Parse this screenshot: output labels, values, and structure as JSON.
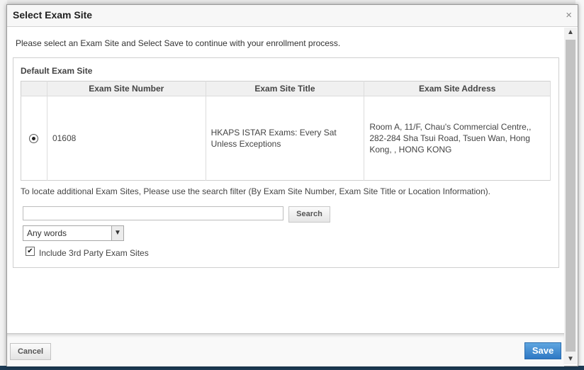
{
  "dialog": {
    "title": "Select Exam Site",
    "close_glyph": "×",
    "intro": "Please select an Exam Site and Select Save to continue with your enrollment process."
  },
  "default_site": {
    "legend": "Default Exam Site",
    "columns": [
      "Exam Site Number",
      "Exam Site Title",
      "Exam Site Address"
    ],
    "rows": [
      {
        "selected": true,
        "number": "01608",
        "title": "HKAPS ISTAR Exams: Every Sat Unless Exceptions",
        "address": "Room A, 11/F, Chau's Commercial Centre,, 282-284 Sha Tsui Road, Tsuen Wan, Hong Kong, , HONG KONG"
      }
    ]
  },
  "search": {
    "instructions": "To locate additional Exam Sites, Please use the search filter (By Exam Site Number, Exam Site Title or Location Information).",
    "input_value": "",
    "button_label": "Search",
    "match_mode": "Any words",
    "include_third_party_label": "Include 3rd Party Exam Sites",
    "include_third_party_checked": true
  },
  "footer": {
    "cancel_label": "Cancel",
    "save_label": "Save"
  },
  "colors": {
    "save_button": "#3a86d0",
    "header_bg": "#f0f0f0"
  },
  "icons": {
    "close": "close-icon",
    "scroll_up": "chevron-up-icon",
    "scroll_down": "chevron-down-icon",
    "dropdown": "chevron-down-icon"
  }
}
